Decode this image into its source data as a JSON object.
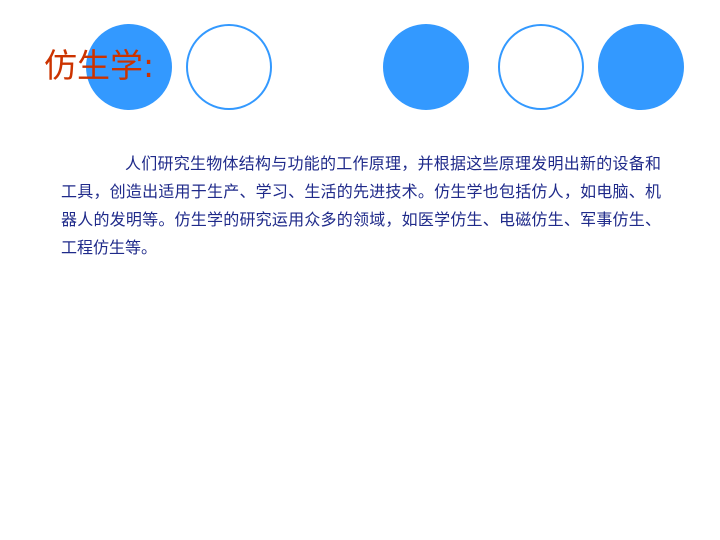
{
  "slide": {
    "title": "仿生学:",
    "body": "人们研究生物体结构与功能的工作原理，并根据这些原理发明出新的设备和工具，创造出适用于生产、学习、生活的先进技术。仿生学也包括仿人，如电脑、机器人的发明等。仿生学的研究运用众多的领域，如医学仿生、电磁仿生、军事仿生、工程仿生等。"
  },
  "decor": {
    "circles": [
      {
        "style": "filled"
      },
      {
        "style": "outline"
      },
      {
        "style": "filled"
      },
      {
        "style": "outline"
      },
      {
        "style": "filled"
      }
    ]
  },
  "colors": {
    "title": "#cc3300",
    "body": "#1f2a8a",
    "circle_fill": "#3399ff",
    "circle_outline": "#3399ff",
    "background": "#ffffff"
  }
}
